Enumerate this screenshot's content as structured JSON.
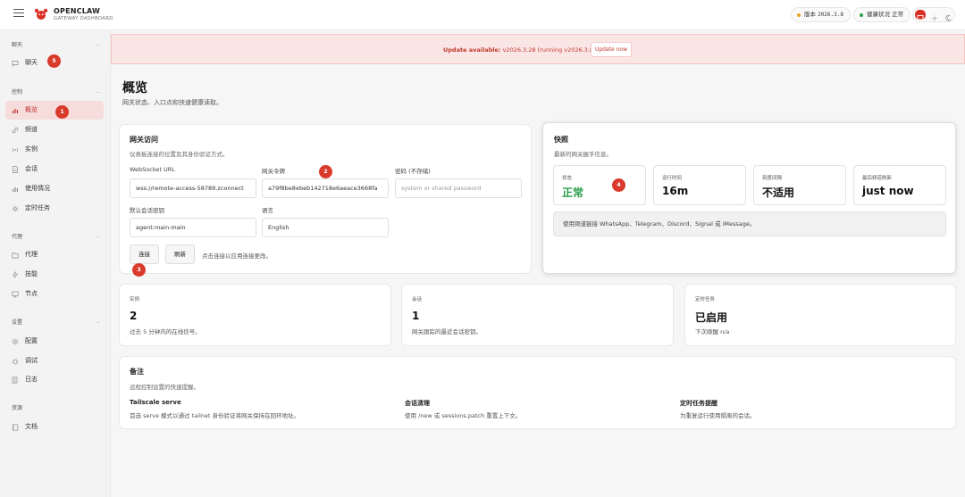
{
  "brand": {
    "name": "OPENCLAW",
    "subtitle": "GATEWAY DASHBOARD"
  },
  "topbar": {
    "version_label": "版本",
    "version_value": "2026.3.8",
    "health_label": "健康状况",
    "health_value": "正常"
  },
  "sidebar": {
    "sections": [
      {
        "title": "聊天",
        "items": [
          {
            "label": "聊天",
            "icon": "chat-icon"
          }
        ]
      },
      {
        "title": "控制",
        "items": [
          {
            "label": "概览",
            "icon": "bar-chart-icon",
            "active": true
          },
          {
            "label": "频道",
            "icon": "link-icon"
          },
          {
            "label": "实例",
            "icon": "broadcast-icon"
          },
          {
            "label": "会话",
            "icon": "document-icon"
          },
          {
            "label": "使用情况",
            "icon": "bar-chart-icon"
          },
          {
            "label": "定时任务",
            "icon": "sparkle-icon"
          }
        ]
      },
      {
        "title": "代理",
        "items": [
          {
            "label": "代理",
            "icon": "folder-icon"
          },
          {
            "label": "技能",
            "icon": "lightning-icon"
          },
          {
            "label": "节点",
            "icon": "monitor-icon"
          }
        ]
      },
      {
        "title": "设置",
        "items": [
          {
            "label": "配置",
            "icon": "gear-icon"
          },
          {
            "label": "调试",
            "icon": "bug-icon"
          },
          {
            "label": "日志",
            "icon": "log-icon"
          }
        ]
      },
      {
        "title": "资源",
        "items": [
          {
            "label": "文档",
            "icon": "book-icon"
          }
        ]
      }
    ]
  },
  "banner": {
    "bold": "Update available:",
    "text": " v2026.3.28 (running v2026.3.8).",
    "button": "Update now"
  },
  "page": {
    "title": "概览",
    "subtitle": "网关状态、入口点和快速健康读取。"
  },
  "gateway": {
    "title": "网关访问",
    "subtitle": "仪表板连接的位置及其身份验证方式。",
    "ws_label": "WebSocket URL",
    "ws_value": "wss://remote-access-58789.zconnect",
    "token_label": "网关令牌",
    "token_value": "a79f8be8ebeb142718e6aeace3668fa",
    "password_label": "密码 (不存储)",
    "password_placeholder": "system or shared password",
    "session_label": "默认会话密钥",
    "session_value": "agent:main:main",
    "lang_label": "语言",
    "lang_value": "English",
    "connect": "连接",
    "refresh": "刷新",
    "hint": "点击连接以应用连接更改。"
  },
  "snapshot": {
    "title": "快照",
    "subtitle": "最新的网关握手信息。",
    "stats": [
      {
        "label": "状态",
        "value": "正常",
        "ok": true
      },
      {
        "label": "运行时间",
        "value": "16m"
      },
      {
        "label": "刻度间隔",
        "value": "不适用"
      },
      {
        "label": "最后频道刷新",
        "value": "just now"
      }
    ],
    "notice": "使用频道链接 WhatsApp、Telegram、Discord、Signal 或 iMessage。"
  },
  "metrics": [
    {
      "label": "实例",
      "value": "2",
      "desc": "过去 5 分钟内的在线信号。"
    },
    {
      "label": "会话",
      "value": "1",
      "desc": "网关跟踪的最近会话密钥。"
    },
    {
      "label": "定时任务",
      "value": "已启用",
      "desc": "下次唤醒 n/a"
    }
  ],
  "notes": {
    "title": "备注",
    "subtitle": "远程控制设置的快速提醒。",
    "items": [
      {
        "title": "Tailscale serve",
        "desc": "首选 serve 模式以通过 tailnet 身份验证将网关保持在回环地址。"
      },
      {
        "title": "会话清理",
        "desc": "使用 /new 或 sessions.patch 重置上下文。"
      },
      {
        "title": "定时任务提醒",
        "desc": "为重复运行使用隔离的会话。"
      }
    ]
  },
  "annotations": [
    "1",
    "2",
    "3",
    "4",
    "5"
  ],
  "colors": {
    "accent": "#d93025",
    "ok": "#2a9d4a",
    "banner_bg": "#fbe6e6"
  }
}
